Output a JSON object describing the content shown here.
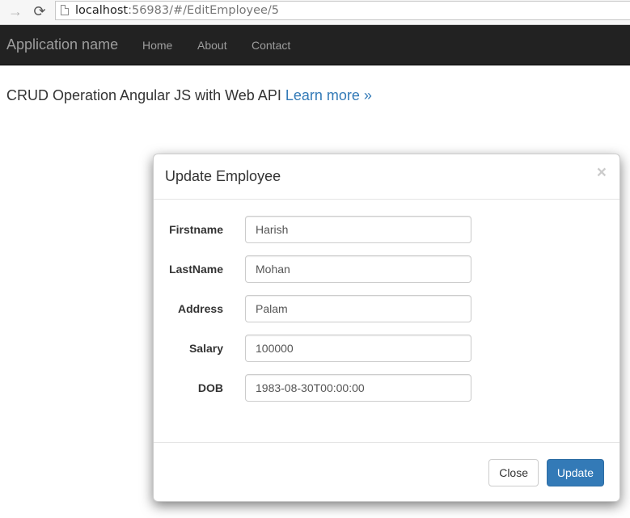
{
  "browser": {
    "url_host": "localhost",
    "url_rest": ":56983/#/EditEmployee/5",
    "back_icon": "arrow-right-icon",
    "reload_icon": "reload-icon"
  },
  "navbar": {
    "brand": "Application name",
    "links": [
      "Home",
      "About",
      "Contact"
    ]
  },
  "lead": {
    "text": "CRUD Operation Angular JS with Web API",
    "link": "Learn more »"
  },
  "modal": {
    "title": "Update Employee",
    "close_glyph": "×",
    "fields": [
      {
        "label": "Firstname",
        "value": "Harish"
      },
      {
        "label": "LastName",
        "value": "Mohan"
      },
      {
        "label": "Address",
        "value": "Palam"
      },
      {
        "label": "Salary",
        "value": "100000"
      },
      {
        "label": "DOB",
        "value": "1983-08-30T00:00:00"
      }
    ],
    "close_button": "Close",
    "update_button": "Update"
  },
  "colors": {
    "navbar_bg": "#222222",
    "link": "#337ab7",
    "primary": "#337ab7"
  }
}
